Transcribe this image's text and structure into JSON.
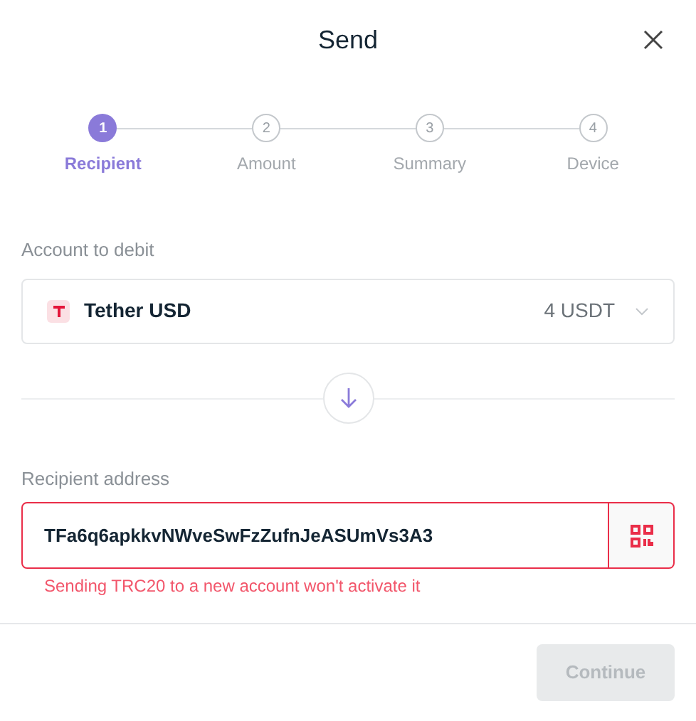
{
  "window": {
    "title": "Send"
  },
  "steps": [
    {
      "number": "1",
      "label": "Recipient",
      "selected": true
    },
    {
      "number": "2",
      "label": "Amount",
      "selected": false
    },
    {
      "number": "3",
      "label": "Summary",
      "selected": false
    },
    {
      "number": "4",
      "label": "Device",
      "selected": false
    }
  ],
  "account": {
    "label": "Account to debit",
    "name": "Tether USD",
    "balance": "4 USDT"
  },
  "recipient": {
    "label": "Recipient address",
    "value": "TFa6q6apkkvNWveSwFzZufnJeASUmVs3A3",
    "error": "Sending TRC20 to a new account won't activate it"
  },
  "continue_button": {
    "label": "Continue",
    "disabled": true
  }
}
